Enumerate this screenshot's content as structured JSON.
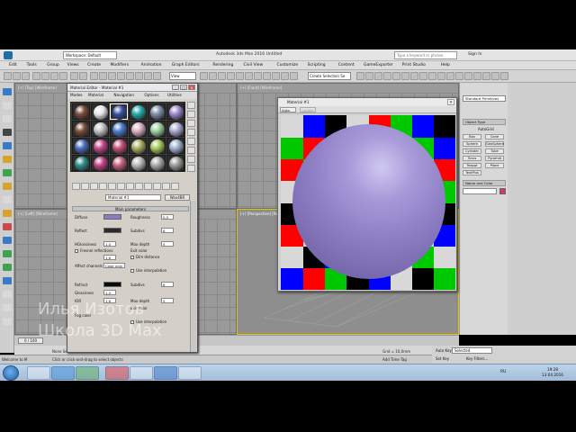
{
  "app": {
    "title": "Autodesk 3ds Max 2016    Untitled",
    "workspace": "Workspace: Default",
    "search_placeholder": "Type a keyword or phrase",
    "sign_in": "Sign In"
  },
  "menubar": [
    "Edit",
    "Tools",
    "Group",
    "Views",
    "Create",
    "Modifiers",
    "Animation",
    "Graph Editors",
    "Rendering",
    "Civil View",
    "Customize",
    "Scripting",
    "Content",
    "GameExporter",
    "Print Studio",
    "Help"
  ],
  "toolbar": {
    "selection_filter": "Create Selection Se",
    "view_dropdown": "View"
  },
  "viewports": {
    "top": "[+] [Top] [Wireframe]",
    "front": "[+] [Front] [Wireframe]",
    "left": "[+] [Left] [Wireframe]",
    "perspective": "[+] [Perspective] [Realistic]"
  },
  "command_panel": {
    "category": "Standard Primitives",
    "rollout_object_type": "Object Type",
    "autogrid": "AutoGrid",
    "buttons": [
      "Box",
      "Cone",
      "Sphere",
      "GeoSphere",
      "Cylinder",
      "Tube",
      "Torus",
      "Pyramid",
      "Teapot",
      "Plane",
      "TextPlus"
    ],
    "rollout_name_color": "Name and Color"
  },
  "material_editor": {
    "title": "Material Editor - Material #1",
    "menus": [
      "Modes",
      "Material",
      "Navigation",
      "Options",
      "Utilities"
    ],
    "material_name": "Material #1",
    "material_type": "Wax4BR",
    "rollout_title": "Main parameters",
    "diffuse_label": "Diffuse",
    "roughness_label": "Roughness",
    "roughness_value": "0,0",
    "reflect_label": "Reflect",
    "subdivs_label": "Subdivs",
    "subdivs_value": "8",
    "hilight_label": "HGlossiness",
    "hilight_value": "1,0",
    "max_depth_label": "Max depth",
    "max_depth_value": "5",
    "fresnel_label": "Fresnel reflections",
    "exit_color_label": "Exit color",
    "fresnel_ior_value": "1,6",
    "dim_distance_label": "Dim distance",
    "affect_channels_label": "Affect channels",
    "affect_channels_value": "Color only",
    "use_interp_label": "Use interpolation",
    "refract_label": "Refract",
    "glossiness_label": "Glossiness",
    "glossiness_value": "1,0",
    "ior_label": "IOR",
    "ior_value": "1,6",
    "refract_subdivs_value": "8",
    "refract_depth_value": "5",
    "refract_exit_label": "Exit color",
    "fog_label": "Fog color",
    "use_interp2_label": "Use interpolation",
    "diffuse_color": "#8a7cc4",
    "reflect_color": "#2a2a2a",
    "refract_color": "#0a0a0a",
    "slot_colors": [
      "#7a4e3a",
      "#e8e8e8",
      "#3a4fa0",
      "#2aa8a8",
      "#7f8fa8",
      "#9a88cc",
      "#7a4e3a",
      "#c0c0c0",
      "#4f7cd0",
      "#d9b0c0",
      "#9ecfa0",
      "#aaa8d0",
      "#4c6ec2",
      "#c04888",
      "#c4507a",
      "#a8b060",
      "#a8c860",
      "#9fb0d0",
      "#2e8e8a",
      "#c04488",
      "#c56080",
      "#b8b8b8",
      "#a8a8a8",
      "#9a9a9a"
    ]
  },
  "preview": {
    "title": "Material #1",
    "auto_label": "Auto",
    "update_label": "Update",
    "checker_rows": [
      [
        "#d8d8d8",
        "#0000ff",
        "#000000",
        "#d8d8d8",
        "#ff0000",
        "#00c800",
        "#0000ff",
        "#000000"
      ],
      [
        "#00c800",
        "#ff0000",
        "#0000ff",
        "#000000",
        "#d8d8d8",
        "#ff0000",
        "#00c800",
        "#0000ff"
      ],
      [
        "#ff0000",
        "#00c800",
        "#d8d8d8",
        "#d8d8d8",
        "#0000ff",
        "#000000",
        "#d8d8d8",
        "#ff0000"
      ],
      [
        "#d8d8d8",
        "#d8d8d8",
        "#00c800",
        "#d8d8d8",
        "#d8d8d8",
        "#0000ff",
        "#000000",
        "#00c800"
      ],
      [
        "#000000",
        "#0000ff",
        "#ff0000",
        "#d8d8d8",
        "#00c800",
        "#d8d8d8",
        "#ff0000",
        "#000000"
      ],
      [
        "#ff0000",
        "#d8d8d8",
        "#d8d8d8",
        "#0000ff",
        "#000000",
        "#00c800",
        "#d8d8d8",
        "#0000ff"
      ],
      [
        "#d8d8d8",
        "#000000",
        "#0000ff",
        "#ff0000",
        "#d8d8d8",
        "#d8d8d8",
        "#00c800",
        "#d8d8d8"
      ],
      [
        "#0000ff",
        "#ff0000",
        "#00c800",
        "#000000",
        "#0000ff",
        "#d8d8d8",
        "#000000",
        "#00c800"
      ]
    ],
    "sphere_color": "#8f80c6"
  },
  "watermark": {
    "line1": "Илья Изотов",
    "line2": "Школа 3D Max"
  },
  "timeline": {
    "frame": "0 / 100",
    "ticks": [
      "0",
      "10",
      "20",
      "30",
      "40",
      "50",
      "60",
      "70",
      "80",
      "90",
      "100"
    ]
  },
  "statusbar": {
    "none_selected": "None Selected",
    "welcome": "Welcome to M",
    "prompt": "Click or click-and-drag to select objects",
    "grid": "Grid = 10,0mm",
    "auto_key": "Auto Key",
    "selected": "Selected",
    "set_key": "Set Key",
    "key_filters": "Key Filters...",
    "add_time_tag": "Add Time Tag"
  },
  "taskbar": {
    "lang": "RU",
    "time": "19:28",
    "date": "13.04.2016"
  }
}
